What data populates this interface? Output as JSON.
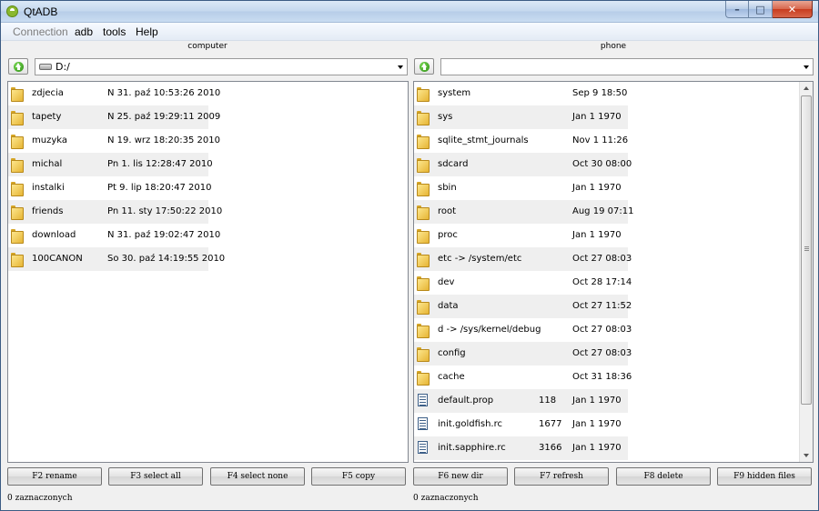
{
  "window": {
    "title": "QtADB"
  },
  "menu": [
    {
      "label": "Connection",
      "disabled": true
    },
    {
      "label": "adb",
      "disabled": false
    },
    {
      "label": "tools",
      "disabled": false
    },
    {
      "label": "Help",
      "disabled": false
    }
  ],
  "computer": {
    "label": "computer",
    "path": "D:/",
    "files": [
      {
        "name": "zdjecia",
        "size": "",
        "date": "N 31. paź 10:53:26 2010",
        "type": "folder"
      },
      {
        "name": "tapety",
        "size": "",
        "date": "N 25. paź 19:29:11 2009",
        "type": "folder"
      },
      {
        "name": "muzyka",
        "size": "",
        "date": "N 19. wrz 18:20:35 2010",
        "type": "folder"
      },
      {
        "name": "michal",
        "size": "",
        "date": "Pn 1. lis 12:28:47 2010",
        "type": "folder"
      },
      {
        "name": "instalki",
        "size": "",
        "date": "Pt 9. lip 18:20:47 2010",
        "type": "folder"
      },
      {
        "name": "friends",
        "size": "",
        "date": "Pn 11. sty 17:50:22 2010",
        "type": "folder"
      },
      {
        "name": "download",
        "size": "",
        "date": "N 31. paź 19:02:47 2010",
        "type": "folder"
      },
      {
        "name": "100CANON",
        "size": "",
        "date": "So 30. paź 14:19:55 2010",
        "type": "folder"
      }
    ],
    "status": "0 zaznaczonych"
  },
  "phone": {
    "label": "phone",
    "path": "",
    "files": [
      {
        "name": "system",
        "size": "",
        "date": "Sep 9 18:50",
        "type": "folder"
      },
      {
        "name": "sys",
        "size": "",
        "date": "Jan 1 1970",
        "type": "folder"
      },
      {
        "name": "sqlite_stmt_journals",
        "size": "",
        "date": "Nov 1 11:26",
        "type": "folder"
      },
      {
        "name": "sdcard",
        "size": "",
        "date": "Oct 30 08:00",
        "type": "folder"
      },
      {
        "name": "sbin",
        "size": "",
        "date": "Jan 1 1970",
        "type": "folder"
      },
      {
        "name": "root",
        "size": "",
        "date": "Aug 19 07:11",
        "type": "folder"
      },
      {
        "name": "proc",
        "size": "",
        "date": "Jan 1 1970",
        "type": "folder"
      },
      {
        "name": "etc -> /system/etc",
        "size": "",
        "date": "Oct 27 08:03",
        "type": "folder"
      },
      {
        "name": "dev",
        "size": "",
        "date": "Oct 28 17:14",
        "type": "folder"
      },
      {
        "name": "data",
        "size": "",
        "date": "Oct 27 11:52",
        "type": "folder"
      },
      {
        "name": "d -> /sys/kernel/debug",
        "size": "",
        "date": "Oct 27 08:03",
        "type": "folder"
      },
      {
        "name": "config",
        "size": "",
        "date": "Oct 27 08:03",
        "type": "folder"
      },
      {
        "name": "cache",
        "size": "",
        "date": "Oct 31 18:36",
        "type": "folder"
      },
      {
        "name": "default.prop",
        "size": "118",
        "date": "Jan 1 1970",
        "type": "file"
      },
      {
        "name": "init.goldfish.rc",
        "size": "1677",
        "date": "Jan 1 1970",
        "type": "file"
      },
      {
        "name": "init.sapphire.rc",
        "size": "3166",
        "date": "Jan 1 1970",
        "type": "file"
      }
    ],
    "status": "0 zaznaczonych"
  },
  "buttons": [
    "F2 rename",
    "F3 select all",
    "F4 select none",
    "F5 copy",
    "F6 new dir",
    "F7 refresh",
    "F8 delete",
    "F9 hidden files"
  ],
  "icons": {
    "folder": "folder-icon",
    "file": "file-icon",
    "up": "up-arrow-icon",
    "drive": "drive-icon"
  }
}
